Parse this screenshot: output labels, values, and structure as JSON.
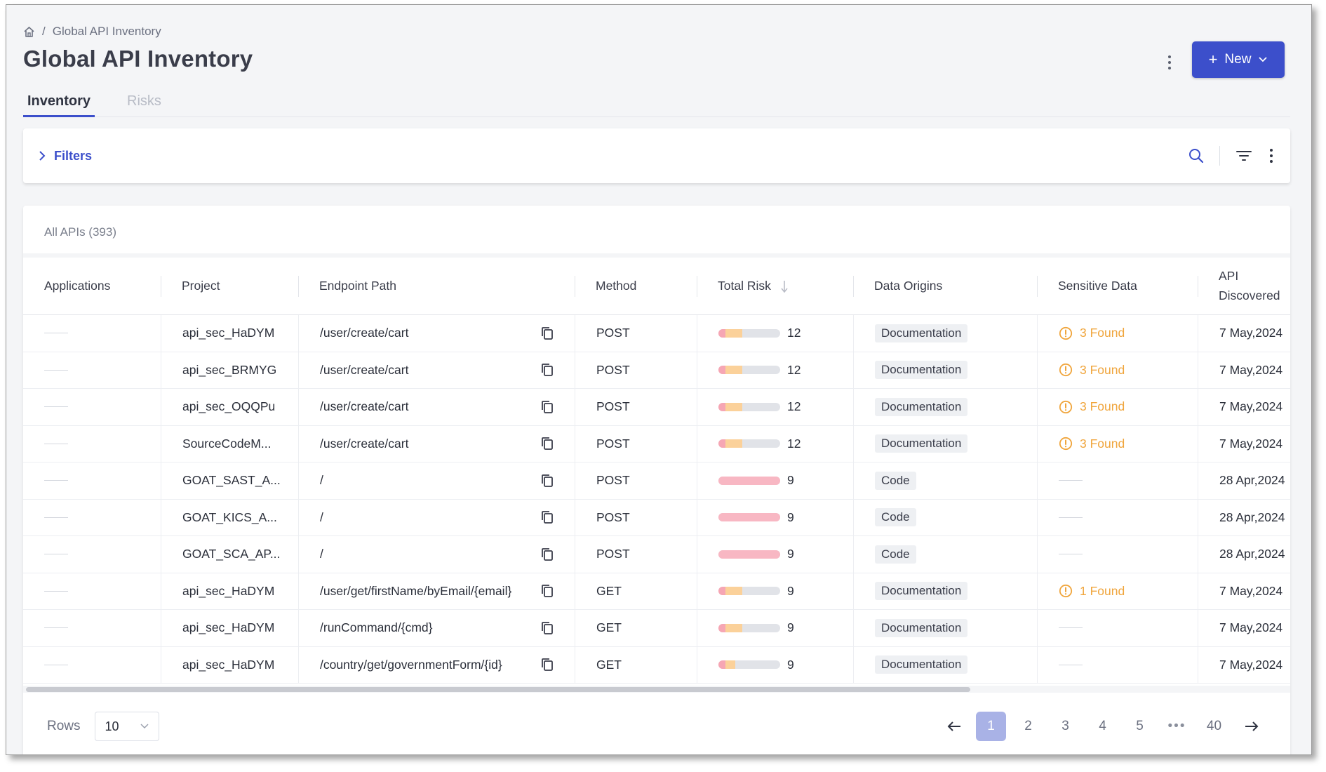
{
  "breadcrumb": {
    "home_icon": "home-icon",
    "separator": "/",
    "current": "Global API Inventory"
  },
  "page": {
    "title": "Global API Inventory"
  },
  "header": {
    "new_label": "New",
    "new_plus": "+"
  },
  "tabs": [
    {
      "label": "Inventory",
      "active": true
    },
    {
      "label": "Risks",
      "active": false
    }
  ],
  "filters": {
    "label": "Filters"
  },
  "table": {
    "caption": "All APIs (393)",
    "columns": {
      "applications": "Applications",
      "project": "Project",
      "endpoint_path": "Endpoint Path",
      "method": "Method",
      "total_risk": "Total Risk",
      "data_origins": "Data Origins",
      "sensitive_data": "Sensitive Data",
      "api_discovered": "API Discovered"
    },
    "rows": [
      {
        "application": "",
        "project": "api_sec_HaDYM",
        "path": "/user/create/cart",
        "method": "POST",
        "risk": "12",
        "origin": "Documentation",
        "sensitive": "3 Found",
        "discovered": "7 May,2024"
      },
      {
        "application": "",
        "project": "api_sec_BRMYG",
        "path": "/user/create/cart",
        "method": "POST",
        "risk": "12",
        "origin": "Documentation",
        "sensitive": "3 Found",
        "discovered": "7 May,2024"
      },
      {
        "application": "",
        "project": "api_sec_OQQPu",
        "path": "/user/create/cart",
        "method": "POST",
        "risk": "12",
        "origin": "Documentation",
        "sensitive": "3 Found",
        "discovered": "7 May,2024"
      },
      {
        "application": "",
        "project": "SourceCodeM...",
        "path": "/user/create/cart",
        "method": "POST",
        "risk": "12",
        "origin": "Documentation",
        "sensitive": "3 Found",
        "discovered": "7 May,2024"
      },
      {
        "application": "",
        "project": "GOAT_SAST_A...",
        "path": "/",
        "method": "POST",
        "risk": "9",
        "origin": "Code",
        "sensitive": "",
        "discovered": "28 Apr,2024"
      },
      {
        "application": "",
        "project": "GOAT_KICS_A...",
        "path": "/",
        "method": "POST",
        "risk": "9",
        "origin": "Code",
        "sensitive": "",
        "discovered": "28 Apr,2024"
      },
      {
        "application": "",
        "project": "GOAT_SCA_AP...",
        "path": "/",
        "method": "POST",
        "risk": "9",
        "origin": "Code",
        "sensitive": "",
        "discovered": "28 Apr,2024"
      },
      {
        "application": "",
        "project": "api_sec_HaDYM",
        "path": "/user/get/firstName/byEmail/{email}",
        "method": "GET",
        "risk": "9",
        "origin": "Documentation",
        "sensitive": "1 Found",
        "discovered": "7 May,2024"
      },
      {
        "application": "",
        "project": "api_sec_HaDYM",
        "path": "/runCommand/{cmd}",
        "method": "GET",
        "risk": "9",
        "origin": "Documentation",
        "sensitive": "",
        "discovered": "7 May,2024"
      },
      {
        "application": "",
        "project": "api_sec_HaDYM",
        "path": "/country/get/governmentForm/{id}",
        "method": "GET",
        "risk": "9",
        "origin": "Documentation",
        "sensitive": "",
        "discovered": "7 May,2024"
      }
    ]
  },
  "footer": {
    "rows_label": "Rows",
    "rows_value": "10",
    "pages": [
      "1",
      "2",
      "3",
      "4",
      "5",
      "•••",
      "40"
    ],
    "current_page": "1"
  },
  "colors": {
    "accent": "#3c4fcb",
    "warning": "#f0a53c",
    "risk_red": "#f6a6b4",
    "risk_orange": "#fbd19a"
  }
}
